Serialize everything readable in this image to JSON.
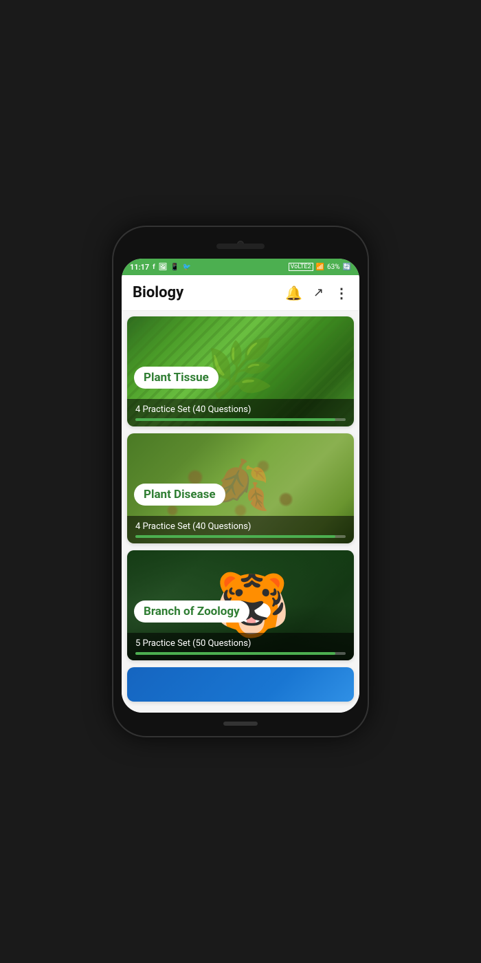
{
  "status_bar": {
    "time": "11:17",
    "battery": "63%",
    "signal_icons": "VoLTE2"
  },
  "app_bar": {
    "title": "Biology",
    "bell_icon": "🔔",
    "share_icon": "⎙",
    "more_icon": "⋮"
  },
  "cards": [
    {
      "id": "plant-tissue",
      "title": "Plant Tissue",
      "subtitle": "4 Practice Set (40 Questions)",
      "progress": 95,
      "image_type": "plant-tissue"
    },
    {
      "id": "plant-disease",
      "title": "Plant Disease",
      "subtitle": "4 Practice Set (40 Questions)",
      "progress": 95,
      "image_type": "plant-disease"
    },
    {
      "id": "branch-of-zoology",
      "title": "Branch of Zoology",
      "subtitle": "5 Practice Set (50 Questions)",
      "progress": 95,
      "image_type": "zoology"
    },
    {
      "id": "fourth-card",
      "title": "",
      "subtitle": "",
      "progress": 0,
      "image_type": "fourth"
    }
  ]
}
